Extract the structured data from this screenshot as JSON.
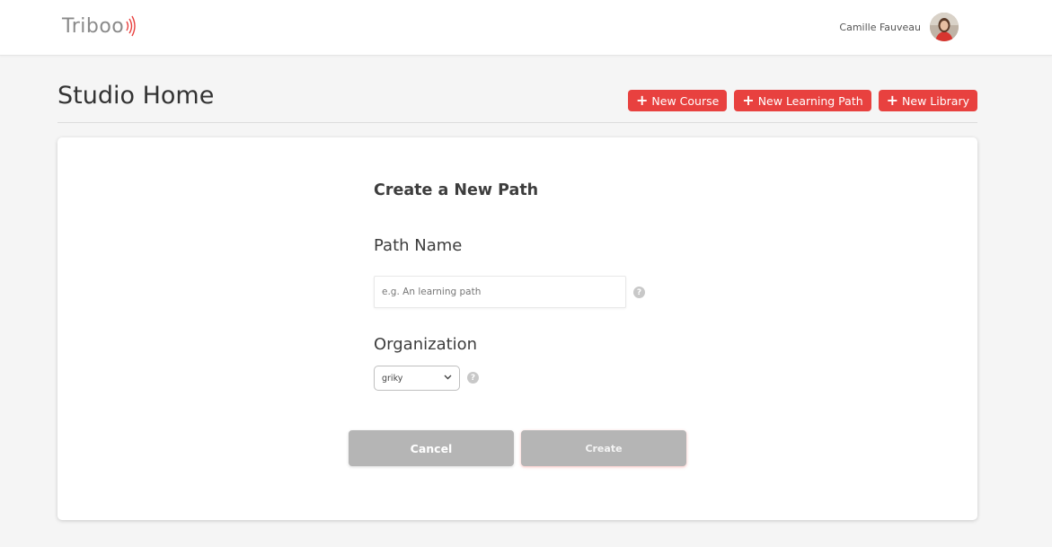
{
  "header": {
    "logo_text": "Triboo",
    "user_name": "Camille Fauveau"
  },
  "page": {
    "title": "Studio Home",
    "actions": [
      {
        "label": "New Course"
      },
      {
        "label": "New Learning Path"
      },
      {
        "label": "New Library"
      }
    ]
  },
  "form": {
    "title": "Create a New Path",
    "path_name_label": "Path Name",
    "path_name_placeholder": "e.g. An learning path",
    "path_name_value": "",
    "organization_label": "Organization",
    "organization_selected": "griky",
    "help_glyph": "?",
    "cancel_label": "Cancel",
    "create_label": "Create"
  },
  "colors": {
    "accent": "#e8413f",
    "button_disabled": "#b5b5b5"
  },
  "icons": {
    "add": "plus-icon",
    "help": "help-icon",
    "dropdown": "chevron-down-icon"
  }
}
